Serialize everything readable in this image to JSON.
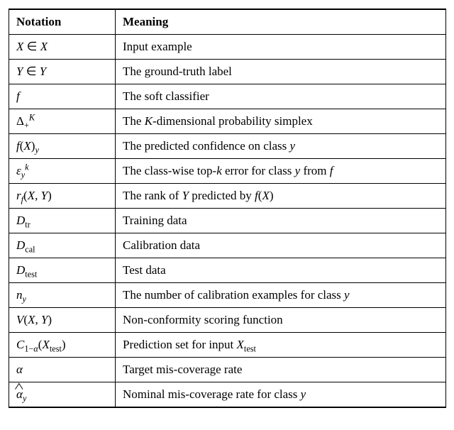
{
  "chart_data": {
    "type": "table",
    "title": "",
    "columns": [
      "Notation",
      "Meaning"
    ],
    "rows": [
      {
        "notation_plain": "X ∈ 𝒳",
        "meaning": "Input example"
      },
      {
        "notation_plain": "Y ∈ 𝒴",
        "meaning": "The ground-truth label"
      },
      {
        "notation_plain": "f",
        "meaning": "The soft classifier"
      },
      {
        "notation_plain": "Δ₊ᴷ",
        "meaning": "The K-dimensional probability simplex"
      },
      {
        "notation_plain": "f(X)_y",
        "meaning": "The predicted confidence on class y"
      },
      {
        "notation_plain": "ε_yᵏ",
        "meaning": "The class-wise top-k error for class y from f"
      },
      {
        "notation_plain": "r_f(X, Y)",
        "meaning": "The rank of Y predicted by f(X)"
      },
      {
        "notation_plain": "𝒟_tr",
        "meaning": "Training data"
      },
      {
        "notation_plain": "𝒟_cal",
        "meaning": "Calibration data"
      },
      {
        "notation_plain": "𝒟_test",
        "meaning": "Test data"
      },
      {
        "notation_plain": "n_y",
        "meaning": "The number of calibration examples for class y"
      },
      {
        "notation_plain": "V(X, Y)",
        "meaning": "Non-conformity scoring function"
      },
      {
        "notation_plain": "𝒞_{1−α}(X_test)",
        "meaning": "Prediction set for input X_test"
      },
      {
        "notation_plain": "α",
        "meaning": "Target mis-coverage rate"
      },
      {
        "notation_plain": "α̂_y",
        "meaning": "Nominal mis-coverage rate for class y"
      }
    ]
  },
  "meaning_rich": {
    "3": "The <span class=\"mathit\">K</span>-dimensional probability simplex",
    "4": "The predicted confidence on class <span class=\"mathit\">y</span>",
    "5": "The class-wise top-<span class=\"mathit\">k</span> error for class <span class=\"mathit\">y</span> from <span class=\"mathit\">f</span>",
    "6": "The rank of <span class=\"mathit\">Y</span> predicted by <span class=\"mathit\">f</span>(<span class=\"mathit\">X</span>)",
    "10": "The number of calibration examples for class <span class=\"mathit\">y</span>",
    "12": "Prediction set for input <span class=\"mathit\">X</span><sub><span class=\"rm\">test</span></sub>",
    "14": "Nominal mis-coverage rate for class <span class=\"mathit\">y</span>"
  },
  "notation_html": {
    "0": "<span class=\"mathit\">X</span> &isin; <span class=\"cal\">X</span>",
    "1": "<span class=\"mathit\">Y</span> &isin; <span class=\"cal\">Y</span>",
    "2": "<span class=\"mathit\">f</span>",
    "3": "&Delta;<sub>+</sub><sup><span class=\"mathit\">K</span></sup>",
    "4": "<span class=\"mathit\">f</span>(<span class=\"mathit\">X</span>)<sub><span class=\"mathit\">y</span></sub>",
    "5": "<span class=\"mathit\">&epsilon;</span><sub><span class=\"mathit\">y</span></sub><sup><span class=\"mathit\">k</span></sup>",
    "6": "<span class=\"mathit\">r</span><sub><span class=\"mathit\">f</span></sub>(<span class=\"mathit\">X</span>, <span class=\"mathit\">Y</span>)",
    "7": "<span class=\"cal\">D</span><sub><span class=\"rm\">tr</span></sub>",
    "8": "<span class=\"cal\">D</span><sub><span class=\"rm\">cal</span></sub>",
    "9": "<span class=\"cal\">D</span><sub><span class=\"rm\">test</span></sub>",
    "10": "<span class=\"mathit\">n</span><sub><span class=\"mathit\">y</span></sub>",
    "11": "<span class=\"mathit\">V</span>(<span class=\"mathit\">X</span>, <span class=\"mathit\">Y</span>)",
    "12": "<span class=\"cal\">C</span><sub>1&minus;<span class=\"mathit\">&alpha;</span></sub>(<span class=\"mathit\">X</span><sub><span class=\"rm\">test</span></sub>)",
    "13": "<span class=\"mathit\">&alpha;</span>",
    "14": "<span class=\"hat\"><span class=\"mathit\">&alpha;</span></span><sub><span class=\"mathit\">y</span></sub>"
  }
}
